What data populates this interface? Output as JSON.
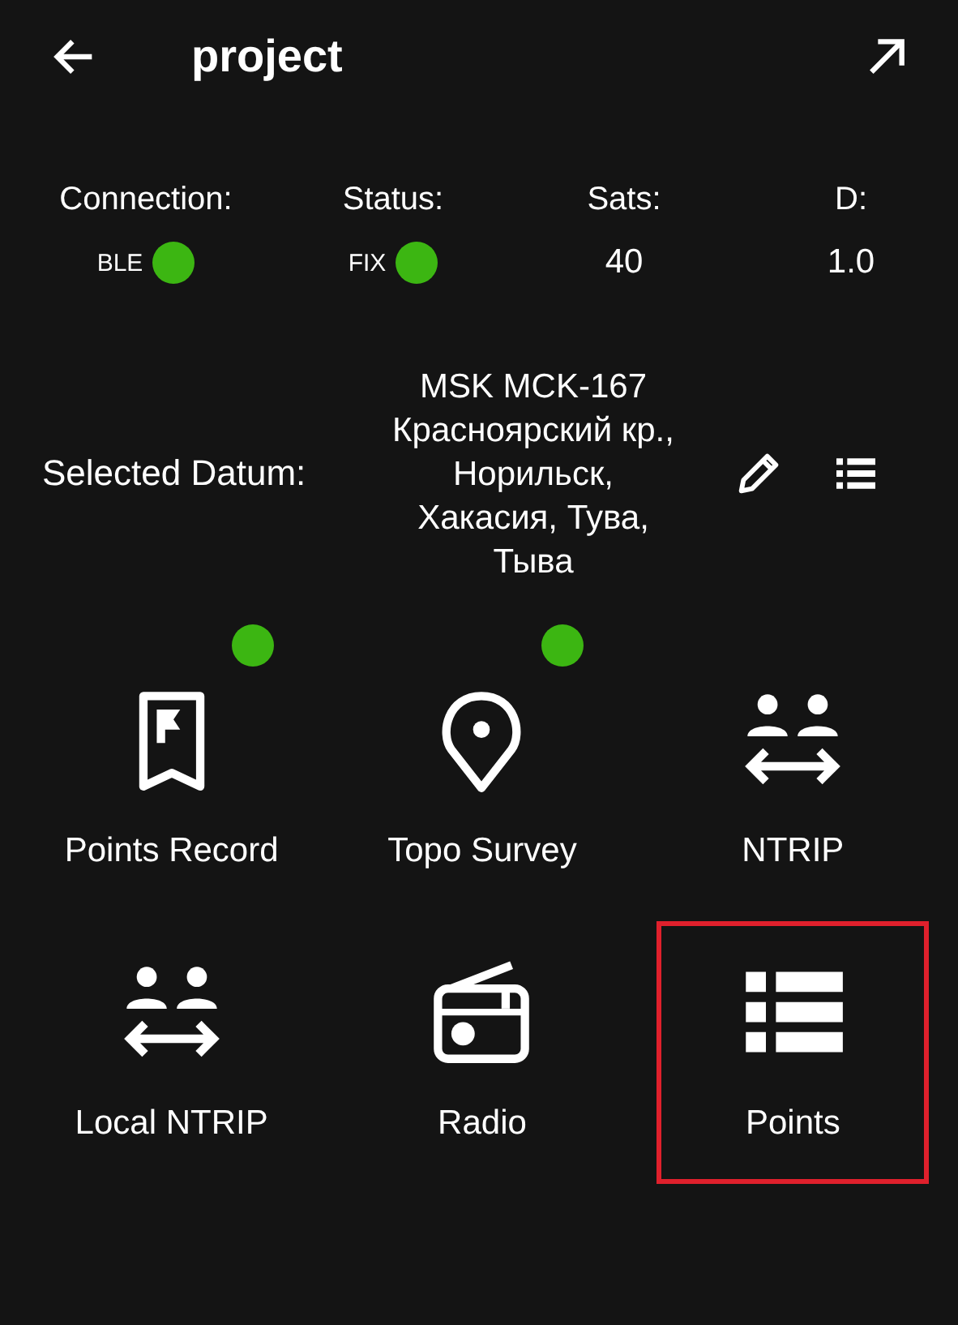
{
  "header": {
    "title": "project"
  },
  "status": [
    {
      "label": "Connection:",
      "value": "BLE",
      "kind": "dot",
      "on": true
    },
    {
      "label": "Status:",
      "value": "FIX",
      "kind": "dot",
      "on": true
    },
    {
      "label": "Sats:",
      "value": "40",
      "kind": "text"
    },
    {
      "label": "D:",
      "value": "1.0",
      "kind": "text"
    }
  ],
  "datum": {
    "label": "Selected Datum:",
    "value": "MSK MCK-167 Красноярский кр., Норильск, Хакасия, Тува, Тыва"
  },
  "tiles": [
    {
      "label": "Points Record",
      "kind": "bookmark",
      "indicator": true,
      "highlighted": false
    },
    {
      "label": "Topo Survey",
      "kind": "pin",
      "indicator": true,
      "highlighted": false
    },
    {
      "label": "NTRIP",
      "kind": "exchange",
      "indicator": false,
      "highlighted": false
    },
    {
      "label": "Local NTRIP",
      "kind": "exchange",
      "indicator": false,
      "highlighted": false
    },
    {
      "label": "Radio",
      "kind": "radio",
      "indicator": false,
      "highlighted": false
    },
    {
      "label": "Points",
      "kind": "list",
      "indicator": false,
      "highlighted": true
    }
  ]
}
